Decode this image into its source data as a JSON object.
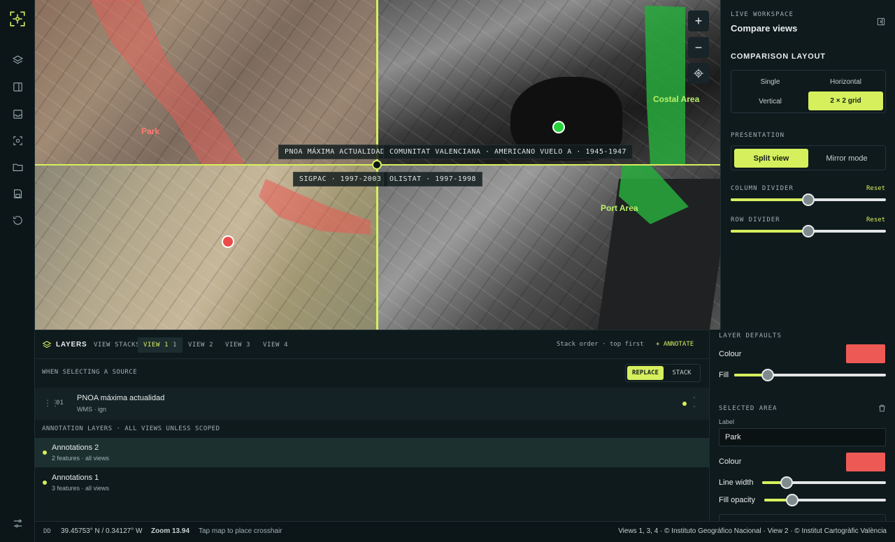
{
  "rail": {
    "icons": [
      "crosshair-logo",
      "layers-icon",
      "split-view-icon",
      "inbox-icon",
      "capture-icon",
      "folder-icon",
      "save-icon",
      "history-icon",
      "settings-icon"
    ]
  },
  "map": {
    "chips": {
      "nw": "PNOA MÁXIMA ACTUALIDAD",
      "ne": "COMUNITAT VALENCIANA · AMERICANO VUELO A · 1945-1947",
      "sw": "SIGPAC · 1997-2003",
      "se": "OLISTAT · 1997-1998"
    },
    "areas": {
      "park": "Park",
      "costal": "Costal Area",
      "port": "Port Area"
    },
    "controls": {
      "zoom_in": "+",
      "zoom_out": "−"
    }
  },
  "panel": {
    "overline": "LIVE WORKSPACE",
    "title": "Compare views",
    "layout_heading": "COMPARISON LAYOUT",
    "layout_options": {
      "single": "Single",
      "horizontal": "Horizontal",
      "vertical": "Vertical",
      "grid": "2 × 2 grid"
    },
    "presentation_heading": "PRESENTATION",
    "presentation": {
      "split": "Split view",
      "mirror": "Mirror mode"
    },
    "column_divider": {
      "label": "COLUMN DIVIDER",
      "reset": "Reset",
      "value": 0.5
    },
    "row_divider": {
      "label": "ROW DIVIDER",
      "reset": "Reset",
      "value": 0.5
    }
  },
  "layers": {
    "title": "LAYERS",
    "tabs": {
      "stacks": "VIEW STACKS",
      "v1": "VIEW 1",
      "v1_count": "1",
      "v2": "VIEW 2",
      "v3": "VIEW 3",
      "v4": "VIEW 4"
    },
    "stack_order": "Stack order · top first",
    "annotate": "ANNOTATE",
    "select_source": "WHEN SELECTING A SOURCE",
    "mode": {
      "replace": "REPLACE",
      "stack": "STACK"
    },
    "source": {
      "index": "01",
      "name": "PNOA máxima actualidad",
      "meta": "WMS · ign"
    },
    "annotation_heading": "ANNOTATION LAYERS · ALL VIEWS UNLESS SCOPED",
    "annotations": [
      {
        "name": "Annotations 2",
        "meta": "2 features · all views"
      },
      {
        "name": "Annotations 1",
        "meta": "3 features · all views"
      }
    ]
  },
  "defaults": {
    "heading": "LAYER DEFAULTS",
    "colour_label": "Colour",
    "fill_label": "Fill",
    "fill_value": 0.22,
    "selected_heading": "SELECTED AREA",
    "label_caption": "Label",
    "label_value": "Park",
    "colour2_label": "Colour",
    "line_width_label": "Line width",
    "line_width_value": 0.2,
    "fill_opacity_label": "Fill opacity",
    "fill_opacity_value": 0.23,
    "colors": {
      "swatch": "#ed5a55",
      "accent": "#d6ef5d"
    }
  },
  "status": {
    "format": "DD",
    "coords": "39.45753° N / 0.34127° W",
    "zoom": "Zoom 13.94",
    "hint": "Tap map to place crosshair",
    "attribution": "Views 1, 3, 4 · © Instituto Geográfico Nacional · View 2 · © Institut Cartogràfic València"
  }
}
